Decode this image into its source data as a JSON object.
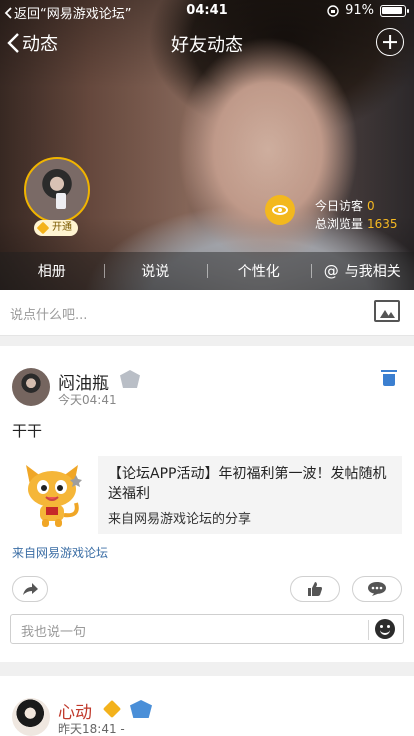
{
  "status_bar": {
    "back_app": "返回“网易游戏论坛”",
    "time": "04:41",
    "battery": "91%"
  },
  "nav": {
    "back_label": "动态",
    "title": "好友动态"
  },
  "profile": {
    "vip_label": "开通",
    "visitors_label": "今日访客",
    "visitors_value": "0",
    "views_label": "总浏览量",
    "views_value": "1635"
  },
  "tabs": [
    {
      "label": "相册"
    },
    {
      "label": "说说"
    },
    {
      "label": "个性化"
    },
    {
      "label": "与我相关"
    }
  ],
  "composer": {
    "placeholder": "说点什么吧..."
  },
  "post": {
    "author": "闷油瓶",
    "time": "今天04:41",
    "content": "干干",
    "share": {
      "title": "【论坛APP活动】年初福利第一波！发帖随机送福利",
      "source": "来自网易游戏论坛的分享"
    },
    "origin": "来自网易游戏论坛",
    "comment_placeholder": "我也说一句"
  },
  "next_post": {
    "author": "心动",
    "time": "昨天18:41 -"
  },
  "icons": {
    "visitor": "eye-icon",
    "add": "plus-circle-icon",
    "delete": "trash-icon",
    "share": "share-arrow-icon",
    "like": "thumbs-up-icon",
    "comment": "chat-bubble-icon",
    "emoji": "smiley-icon",
    "photo": "image-icon"
  },
  "colors": {
    "accent_gold": "#f3b81d",
    "link_blue": "#3b6ea5",
    "trash_blue": "#3b7fd0",
    "name_red": "#c0392b"
  }
}
